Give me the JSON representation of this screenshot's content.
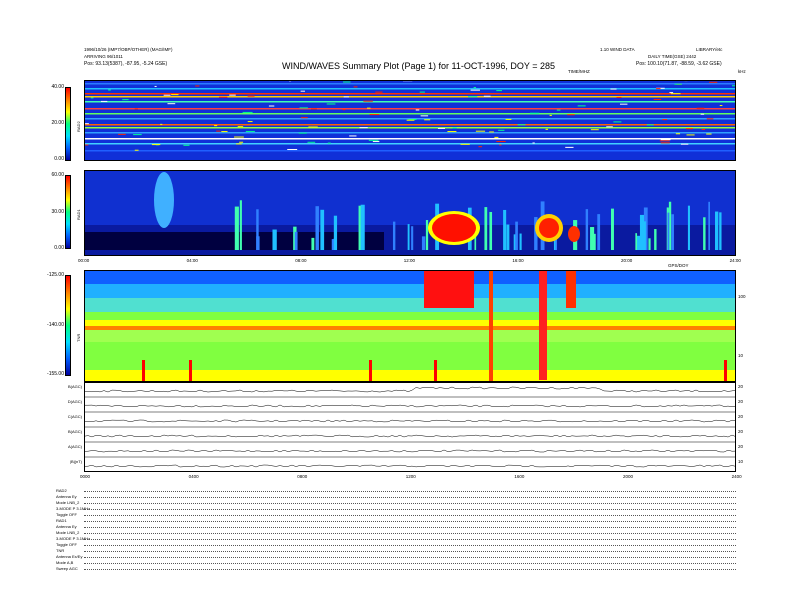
{
  "header": {
    "title": "WIND/WAVES Summary Plot (Page 1) for 11-OCT-1996, DOY = 285",
    "left_line1": "1996/10/26 (IMP7/OBP/OTHER) (MAG/IMF)",
    "left_line2": "ARRIVING 96/1011",
    "left_line3_label": "Pos:",
    "left_line3_value": "93.13(5387), -87.95, -5.24 GSE)",
    "right_line1": "1.10 WIND DATA",
    "right_line1b": "LIBRARY/etc",
    "right_line2": "DAILY TIME(GSE) 2442",
    "right_line3_label": "Pos:",
    "right_line3_value": "100.10(71.87, -88.59, -3.62 GSE)",
    "top_unit_left": "TIME/MHZ",
    "top_unit_right": "kHz"
  },
  "panels": {
    "rad2": {
      "label": "RAD2",
      "ticks": [
        "40.00",
        "20.00",
        "0.00"
      ]
    },
    "rad1": {
      "label": "RAD1",
      "ticks": [
        "60.00",
        "30.00",
        "0.00"
      ]
    },
    "tnr": {
      "label": "TNR",
      "ticks": [
        "-125.00",
        "-140.00",
        "-155.00"
      ],
      "right_ticks": [
        "100",
        "10"
      ]
    },
    "time_ticks_mid": [
      "00:00",
      "04:00",
      "08:00",
      "12:00",
      "16:00",
      "20:00",
      "24:00"
    ],
    "time_unit_mid": "GPS/DOY",
    "line_panels": [
      {
        "label": "B(AGC)",
        "right": "20"
      },
      {
        "label": "D(AGC)",
        "right": "20"
      },
      {
        "label": "C(AGC)",
        "right": "20"
      },
      {
        "label": "B(AGC)",
        "right": "20"
      },
      {
        "label": "A(AGC)",
        "right": "20"
      },
      {
        "label": "|B|(nT)",
        "right": "10"
      }
    ],
    "time_ticks_bottom": [
      "0000",
      "0400",
      "0800",
      "1200",
      "1600",
      "2000",
      "2400"
    ]
  },
  "info_rows": [
    "RAD2",
    "Antenna   Ey",
    "Mode   LNB_2",
    "3-MODE P 3.1MHz",
    "Toggle   OFF",
    "RAD1",
    "Antenna   Ey",
    "Mode   LNB_2",
    "3-MODE P 3.1MHz",
    "Toggle   OFF",
    "TNR",
    "Antenna   Ex/Ey",
    "Mode   A,B",
    "Sweep   AGC"
  ],
  "colors": {
    "low": "#0000c0",
    "mid": "#00ff80",
    "high": "#ff0000"
  }
}
